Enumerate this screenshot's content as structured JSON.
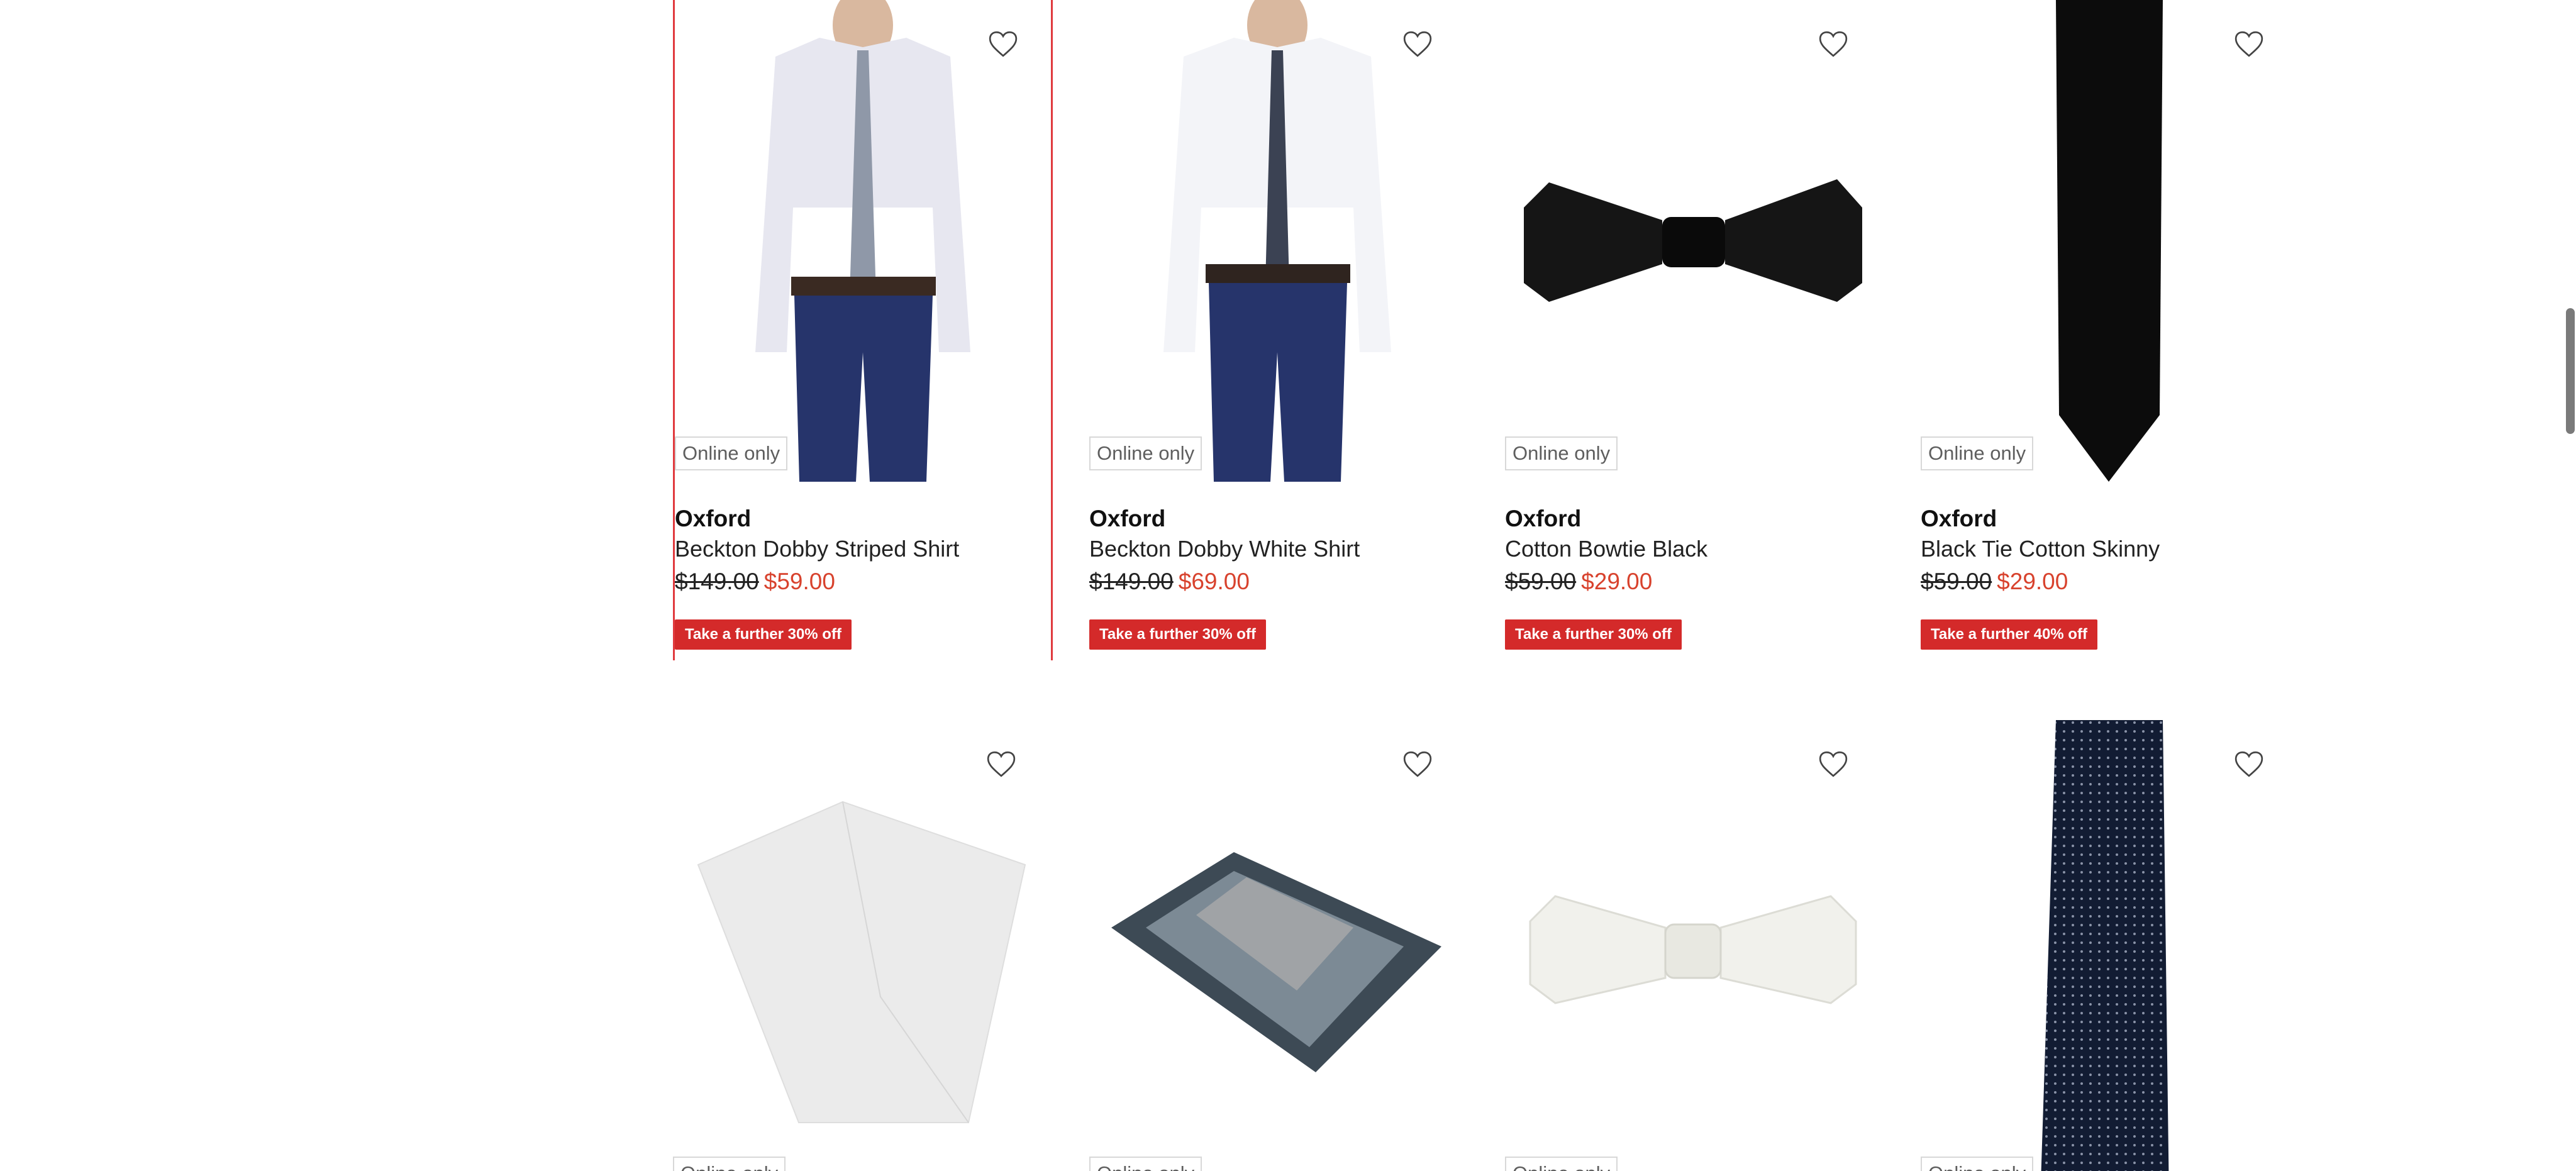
{
  "labels": {
    "online_only": "Online only"
  },
  "products": [
    {
      "brand": "Oxford",
      "name": "Beckton Dobby Striped Shirt",
      "was_price": "$149.00",
      "now_price": "$59.00",
      "promo": "Take a further 30% off"
    },
    {
      "brand": "Oxford",
      "name": "Beckton Dobby White Shirt",
      "was_price": "$149.00",
      "now_price": "$69.00",
      "promo": "Take a further 30% off"
    },
    {
      "brand": "Oxford",
      "name": "Cotton Bowtie Black",
      "was_price": "$59.00",
      "now_price": "$29.00",
      "promo": "Take a further 30% off"
    },
    {
      "brand": "Oxford",
      "name": "Black Tie Cotton Skinny",
      "was_price": "$59.00",
      "now_price": "$29.00",
      "promo": "Take a further 40% off"
    }
  ],
  "colors": {
    "promo_bg": "#d42a2a",
    "sale_price": "#d8422d",
    "selected_outline": "#e03a3e"
  },
  "icons": {
    "wishlist": "heart-outline-icon"
  }
}
